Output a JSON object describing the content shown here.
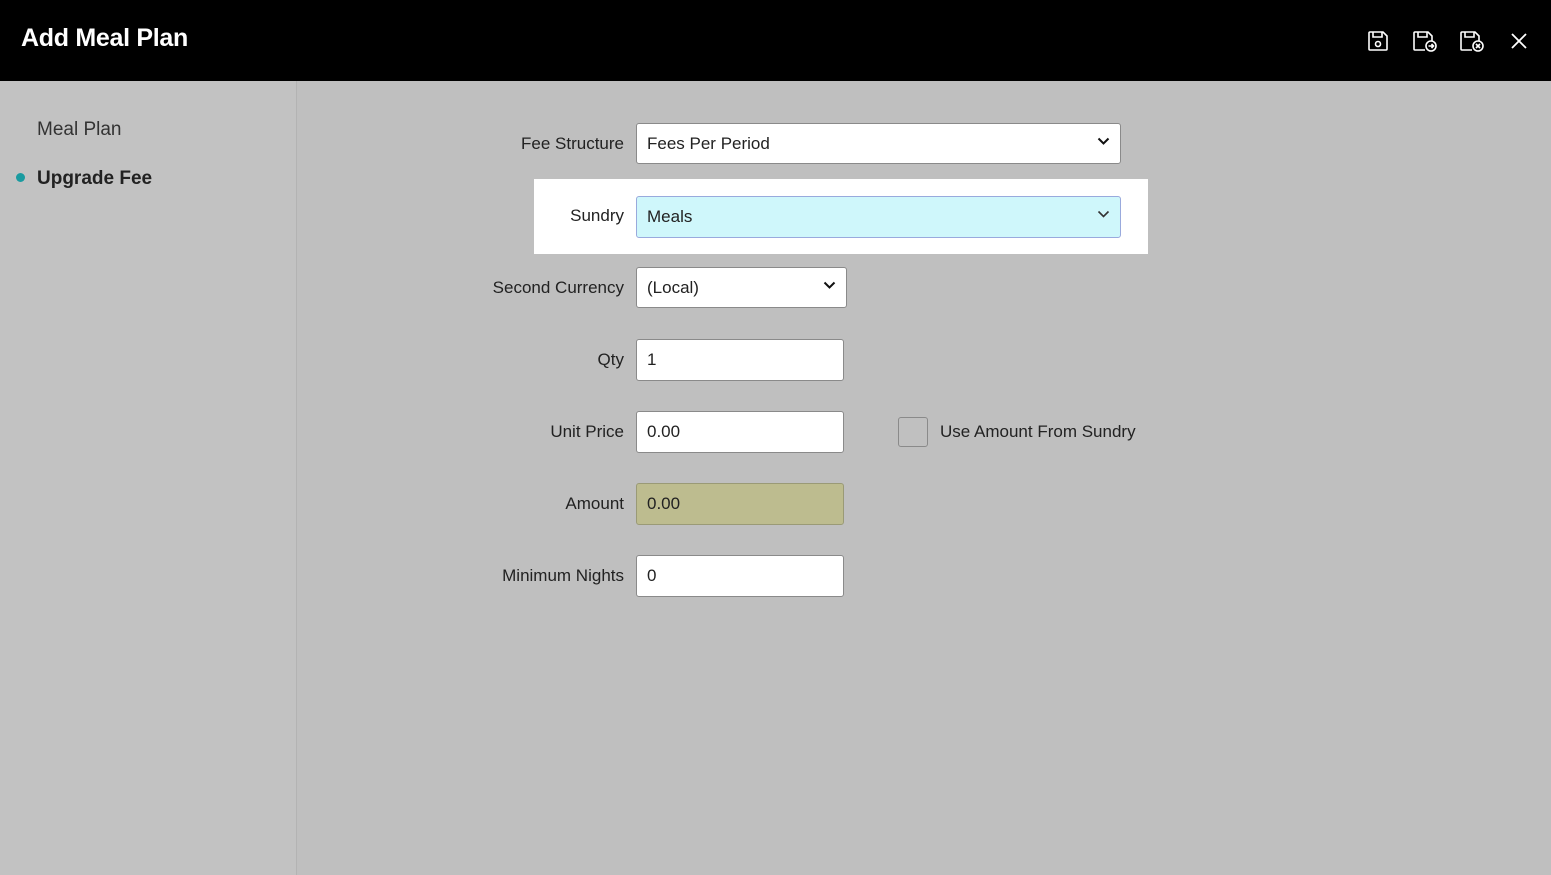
{
  "header": {
    "title": "Add Meal Plan",
    "icons": [
      "save-icon",
      "save-and-new-icon",
      "save-and-close-icon",
      "close-icon"
    ]
  },
  "sidebar": {
    "items": [
      {
        "label": "Meal Plan",
        "active": false
      },
      {
        "label": "Upgrade Fee",
        "active": true
      }
    ],
    "accent": "#1a9ba0"
  },
  "form": {
    "fee_structure": {
      "label": "Fee Structure",
      "value": "Fees Per Period"
    },
    "sundry": {
      "label": "Sundry",
      "value": "Meals"
    },
    "second_currency": {
      "label": "Second Currency",
      "value": "(Local)"
    },
    "qty": {
      "label": "Qty",
      "value": "1"
    },
    "unit_price": {
      "label": "Unit Price",
      "value": "0.00"
    },
    "use_amount_from_sundry": {
      "label": "Use Amount From Sundry",
      "checked": false
    },
    "amount": {
      "label": "Amount",
      "value": "0.00"
    },
    "minimum_nights": {
      "label": "Minimum Nights",
      "value": "0"
    }
  },
  "colors": {
    "header_bg": "#000000",
    "sundry_bg": "#cff7fb",
    "amount_bg": "#bdbc8f"
  }
}
